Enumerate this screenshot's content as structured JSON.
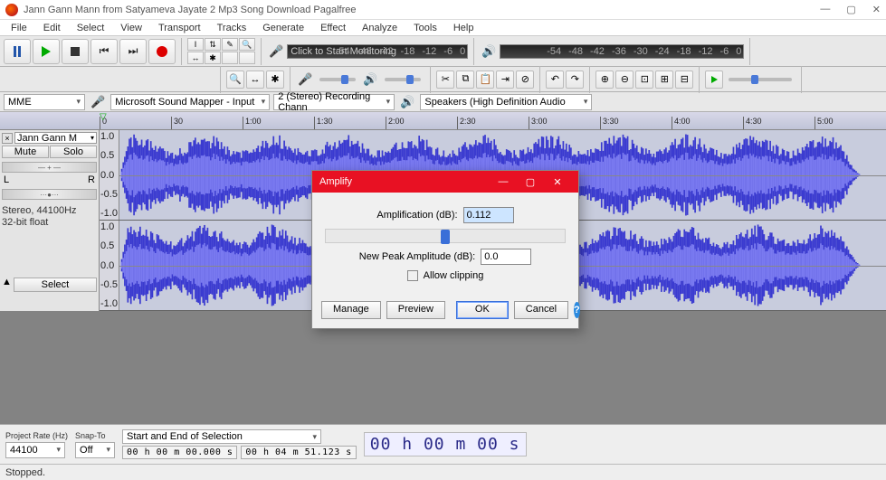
{
  "window": {
    "title": "Jann Gann Mann from Satyameva Jayate 2 Mp3 Song Download Pagalfree"
  },
  "menu": [
    "File",
    "Edit",
    "Select",
    "View",
    "Transport",
    "Tracks",
    "Generate",
    "Effect",
    "Analyze",
    "Tools",
    "Help"
  ],
  "device_bar": {
    "host": "MME",
    "rec_device": "Microsoft Sound Mapper - Input",
    "rec_channels": "2 (Stereo) Recording Chann",
    "play_device": "Speakers (High Definition Audio"
  },
  "rec_meter": {
    "label": "Click to Start Monitoring",
    "ticks": [
      "-54",
      "-48",
      "-42",
      "-18",
      "-12",
      "-6",
      "0"
    ]
  },
  "play_meter": {
    "ticks": [
      "-54",
      "-48",
      "-42",
      "-36",
      "-30",
      "-24",
      "-18",
      "-12",
      "-6",
      "0"
    ]
  },
  "timeline_marks": [
    "0",
    "30",
    "1:00",
    "1:30",
    "2:00",
    "2:30",
    "3:00",
    "3:30",
    "4:00",
    "4:30",
    "5:00"
  ],
  "track": {
    "name": "Jann Gann M",
    "mute": "Mute",
    "solo": "Solo",
    "left": "L",
    "right": "R",
    "info1": "Stereo, 44100Hz",
    "info2": "32-bit float",
    "select": "Select",
    "vscale": [
      "1.0",
      "0.5",
      "0.0",
      "-0.5",
      "-1.0"
    ]
  },
  "selection_bar": {
    "project_rate_label": "Project Rate (Hz)",
    "project_rate": "44100",
    "snap_label": "Snap-To",
    "snap": "Off",
    "sel_label": "Start and End of Selection",
    "start": "00 h 00 m 00.000 s",
    "end": "00 h 04 m 51.123 s",
    "big_time": "00 h 00 m 00 s"
  },
  "status": "Stopped.",
  "dialog": {
    "title": "Amplify",
    "amp_label": "Amplification (dB):",
    "amp_value": "0.112",
    "peak_label": "New Peak Amplitude (dB):",
    "peak_value": "0.0",
    "clip_label": "Allow clipping",
    "manage": "Manage",
    "preview": "Preview",
    "ok": "OK",
    "cancel": "Cancel"
  }
}
